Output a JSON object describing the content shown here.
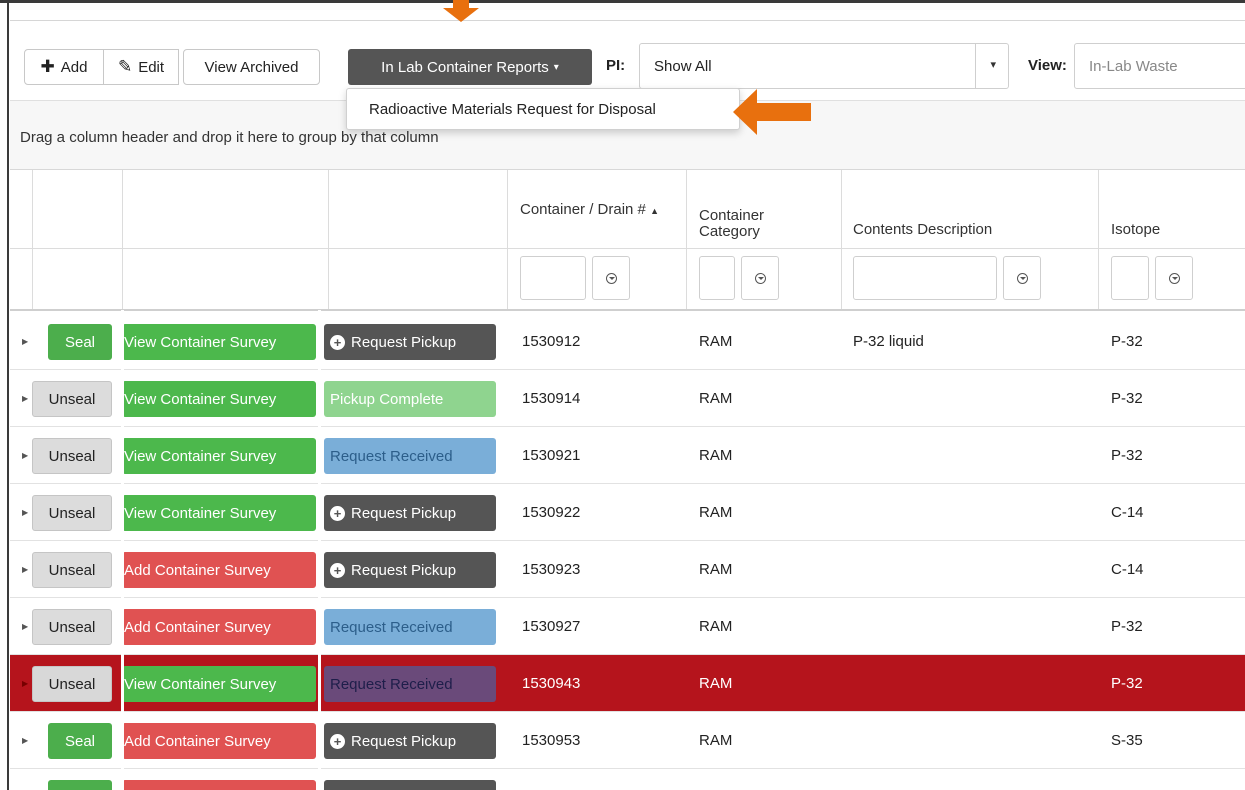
{
  "toolbar": {
    "add_label": "Add",
    "edit_label": "Edit",
    "view_archived_label": "View Archived",
    "reports_label": "In Lab Container Reports",
    "pi_label": "PI:",
    "pi_value": "Show All",
    "view_label": "View:",
    "view_placeholder": "In-Lab Waste"
  },
  "reports_menu": {
    "items": [
      "Radioactive Materials Request for Disposal"
    ]
  },
  "group_hint": "Drag a column header and drop it here to group by that column",
  "columns": {
    "container_num": "Container / Drain #",
    "category": "Container Category",
    "contents": "Contents Description",
    "isotope": "Isotope"
  },
  "rows": [
    {
      "seal": "Seal",
      "survey": "View Container Survey",
      "request": "Request Pickup",
      "num": "1530912",
      "cat": "RAM",
      "desc": "P-32 liquid",
      "iso": "P-32"
    },
    {
      "seal": "Unseal",
      "survey": "View Container Survey",
      "request": "Pickup Complete",
      "num": "1530914",
      "cat": "RAM",
      "desc": "",
      "iso": "P-32"
    },
    {
      "seal": "Unseal",
      "survey": "View Container Survey",
      "request": "Request Received",
      "num": "1530921",
      "cat": "RAM",
      "desc": "",
      "iso": "P-32"
    },
    {
      "seal": "Unseal",
      "survey": "View Container Survey",
      "request": "Request Pickup",
      "num": "1530922",
      "cat": "RAM",
      "desc": "",
      "iso": "C-14"
    },
    {
      "seal": "Unseal",
      "survey": "Add Container Survey",
      "request": "Request Pickup",
      "num": "1530923",
      "cat": "RAM",
      "desc": "",
      "iso": "C-14"
    },
    {
      "seal": "Unseal",
      "survey": "Add Container Survey",
      "request": "Request Received",
      "num": "1530927",
      "cat": "RAM",
      "desc": "",
      "iso": "P-32"
    },
    {
      "seal": "Unseal",
      "survey": "View Container Survey",
      "request": "Request Received",
      "num": "1530943",
      "cat": "RAM",
      "desc": "",
      "iso": "P-32"
    },
    {
      "seal": "Seal",
      "survey": "Add Container Survey",
      "request": "Request Pickup",
      "num": "1530953",
      "cat": "RAM",
      "desc": "",
      "iso": "S-35"
    }
  ],
  "colors": {
    "accent_arrow": "#e8700e",
    "seal_green": "#4cae4c",
    "survey_add_red": "#e05252",
    "selected_row": "#b5141c",
    "request_dark": "#555555"
  }
}
